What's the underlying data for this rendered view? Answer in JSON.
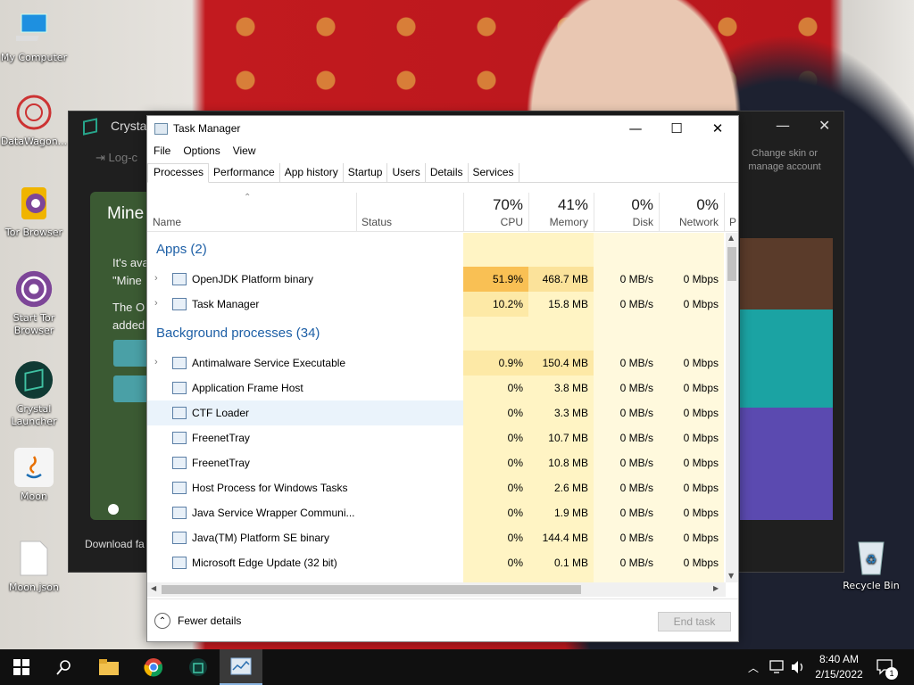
{
  "desktop": {
    "icons": [
      {
        "label": "My Computer"
      },
      {
        "label": "DataWagon..."
      },
      {
        "label": "Tor Browser"
      },
      {
        "label": "Start Tor Browser"
      },
      {
        "label": "Crystal Launcher"
      },
      {
        "label": "Moon"
      },
      {
        "label": "Moon.json"
      }
    ],
    "recycle_bin": "Recycle Bin"
  },
  "crystal": {
    "title": "Crysta",
    "logout": "Log-c",
    "skin": "Change skin or manage account",
    "card_title": "Mine",
    "card_text_1": "It's ava",
    "card_text_2": "\"Mine",
    "card_text_3": "The O",
    "card_text_4": "added",
    "download": "Download fa"
  },
  "taskmanager": {
    "title": "Task Manager",
    "controls": {
      "minimize": "—",
      "maximize": "☐",
      "close": "✕"
    },
    "menu": [
      "File",
      "Options",
      "View"
    ],
    "tabs": [
      "Processes",
      "Performance",
      "App history",
      "Startup",
      "Users",
      "Details",
      "Services"
    ],
    "columns": {
      "name": "Name",
      "status": "Status",
      "cpu": {
        "pct": "70%",
        "label": "CPU"
      },
      "memory": {
        "pct": "41%",
        "label": "Memory"
      },
      "disk": {
        "pct": "0%",
        "label": "Disk"
      },
      "network": {
        "pct": "0%",
        "label": "Network"
      },
      "power": "P"
    },
    "groups": {
      "apps": "Apps (2)",
      "background": "Background processes (34)"
    },
    "apps": [
      {
        "name": "OpenJDK Platform binary",
        "cpu": "51.9%",
        "mem": "468.7 MB",
        "disk": "0 MB/s",
        "net": "0 Mbps"
      },
      {
        "name": "Task Manager",
        "cpu": "10.2%",
        "mem": "15.8 MB",
        "disk": "0 MB/s",
        "net": "0 Mbps"
      }
    ],
    "background": [
      {
        "name": "Antimalware Service Executable",
        "cpu": "0.9%",
        "mem": "150.4 MB",
        "disk": "0 MB/s",
        "net": "0 Mbps"
      },
      {
        "name": "Application Frame Host",
        "cpu": "0%",
        "mem": "3.8 MB",
        "disk": "0 MB/s",
        "net": "0 Mbps"
      },
      {
        "name": "CTF Loader",
        "cpu": "0%",
        "mem": "3.3 MB",
        "disk": "0 MB/s",
        "net": "0 Mbps"
      },
      {
        "name": "FreenetTray",
        "cpu": "0%",
        "mem": "10.7 MB",
        "disk": "0 MB/s",
        "net": "0 Mbps"
      },
      {
        "name": "FreenetTray",
        "cpu": "0%",
        "mem": "10.8 MB",
        "disk": "0 MB/s",
        "net": "0 Mbps"
      },
      {
        "name": "Host Process for Windows Tasks",
        "cpu": "0%",
        "mem": "2.6 MB",
        "disk": "0 MB/s",
        "net": "0 Mbps"
      },
      {
        "name": "Java Service Wrapper Communi...",
        "cpu": "0%",
        "mem": "1.9 MB",
        "disk": "0 MB/s",
        "net": "0 Mbps"
      },
      {
        "name": "Java(TM) Platform SE binary",
        "cpu": "0%",
        "mem": "144.4 MB",
        "disk": "0 MB/s",
        "net": "0 Mbps"
      },
      {
        "name": "Microsoft Edge Update (32 bit)",
        "cpu": "0%",
        "mem": "0.1 MB",
        "disk": "0 MB/s",
        "net": "0 Mbps"
      }
    ],
    "fewer_details": "Fewer details",
    "end_task": "End task"
  },
  "taskbar": {
    "time": "8:40 AM",
    "date": "2/15/2022",
    "notification_count": "1"
  }
}
